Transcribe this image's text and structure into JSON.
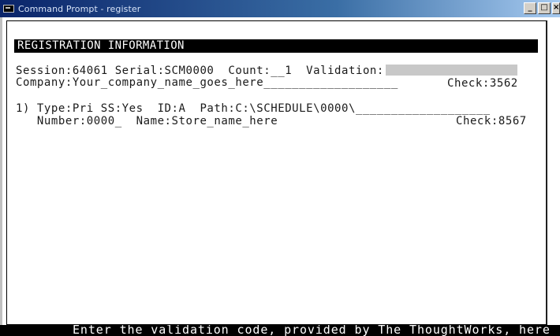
{
  "window": {
    "title": "Command Prompt - register",
    "min_label": "_",
    "max_label": "□",
    "close_label": "×"
  },
  "header": {
    "title": "REGISTRATION INFORMATION"
  },
  "registration": {
    "line1": "Session:64061 Serial:SCM0000  Count:__1  Validation:",
    "validation_value": "",
    "line2_company": "Company:Your_company_name_goes_here___________________",
    "line2_check": "Check:3562"
  },
  "store_entries": [
    {
      "line1": "1) Type:Pri SS:Yes  ID:A  Path:C:\\SCHEDULE\\0000\\___________________",
      "line2": "   Number:0000_  Name:Store_name_here",
      "check": "Check:8567"
    }
  ],
  "status": {
    "prompt": "Enter the validation code, provided by The ThoughtWorks, here"
  },
  "colors": {
    "titlebar_start": "#0a246a",
    "console_bg": "#ffffff",
    "console_text": "#1a1a1a",
    "field_bg": "#c8c8c8"
  }
}
